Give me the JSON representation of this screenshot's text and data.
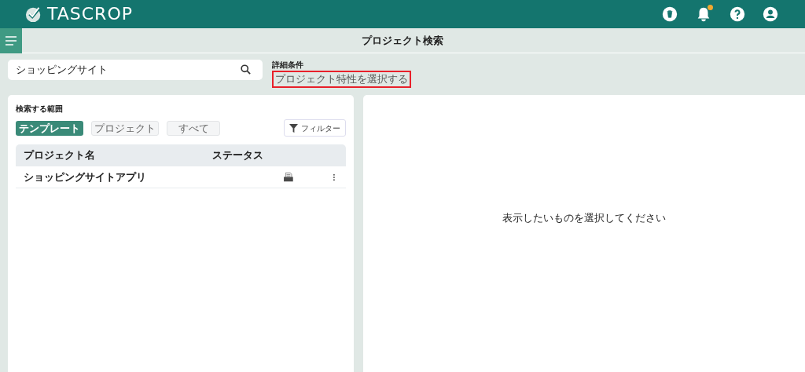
{
  "header": {
    "logo": "TASCROP",
    "notification_badge": true
  },
  "page_title": "プロジェクト検索",
  "search": {
    "value": "ショッピングサイト"
  },
  "details": {
    "label": "詳細条件",
    "link": "プロジェクト特性を選択する",
    "highlighted": true
  },
  "scope": {
    "label": "検索する範囲",
    "tabs": [
      {
        "label": "テンプレート",
        "selected": true
      },
      {
        "label": "プロジェクト",
        "selected": false
      },
      {
        "label": "すべて",
        "selected": false
      }
    ],
    "filter_button": "フィルター"
  },
  "table": {
    "columns": [
      "プロジェクト名",
      "ステータス"
    ],
    "rows": [
      {
        "name": "ショッピングサイトアプリ"
      }
    ]
  },
  "detail_panel": {
    "message": "表示したいものを選択してください"
  }
}
